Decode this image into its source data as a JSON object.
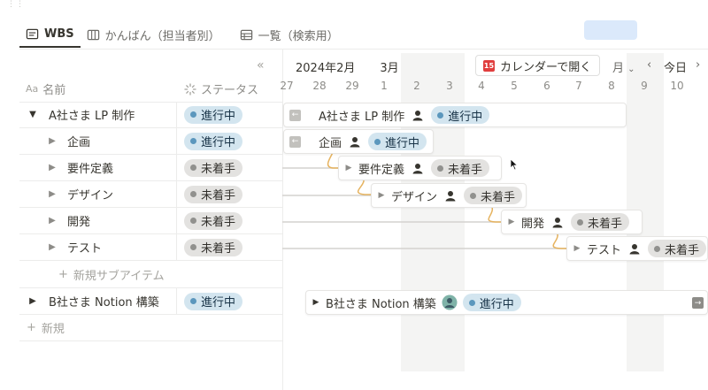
{
  "views": {
    "tabs": [
      {
        "label": "WBS",
        "active": true,
        "icon": "table-icon"
      },
      {
        "label": "かんばん（担当者別）",
        "active": false,
        "icon": "board-icon"
      },
      {
        "label": "一覧（検索用）",
        "active": false,
        "icon": "list-icon"
      }
    ]
  },
  "table": {
    "headers": {
      "name": "名前",
      "name_prefix": "Aa",
      "status": "ステータス"
    },
    "rows": [
      {
        "name": "A社さま LP 制作",
        "status": "進行中",
        "level": 0,
        "expanded": true
      },
      {
        "name": "企画",
        "status": "進行中",
        "level": 1
      },
      {
        "name": "要件定義",
        "status": "未着手",
        "level": 1
      },
      {
        "name": "デザイン",
        "status": "未着手",
        "level": 1
      },
      {
        "name": "開発",
        "status": "未着手",
        "level": 1
      },
      {
        "name": "テスト",
        "status": "未着手",
        "level": 1
      }
    ],
    "new_sub_item": "新規サブアイテム",
    "row_b": {
      "name": "B社さま Notion 構築",
      "status": "進行中"
    },
    "new_item": "新規"
  },
  "timeline": {
    "month_label": "2024年2月",
    "next_month_label": "3月",
    "calendar_button": "カレンダーで開く",
    "scale": "月",
    "today": "今日",
    "days": [
      "27",
      "28",
      "29",
      "1",
      "2",
      "3",
      "4",
      "5",
      "6",
      "7",
      "8",
      "9",
      "10"
    ],
    "bars": [
      {
        "name": "A社さま LP 制作",
        "status": "進行中"
      },
      {
        "name": "企画",
        "status": "進行中"
      },
      {
        "name": "要件定義",
        "status": "未着手"
      },
      {
        "name": "デザイン",
        "status": "未着手"
      },
      {
        "name": "開発",
        "status": "未着手"
      },
      {
        "name": "テスト",
        "status": "未着手"
      },
      {
        "name": "B社さま Notion 構築",
        "status": "進行中"
      }
    ]
  },
  "colors": {
    "status_in_progress_bg": "#d3e5ef",
    "status_not_started_bg": "#e3e2e0",
    "dependency_line": "#e6b35f",
    "calendar_icon": "#e03e3e"
  }
}
